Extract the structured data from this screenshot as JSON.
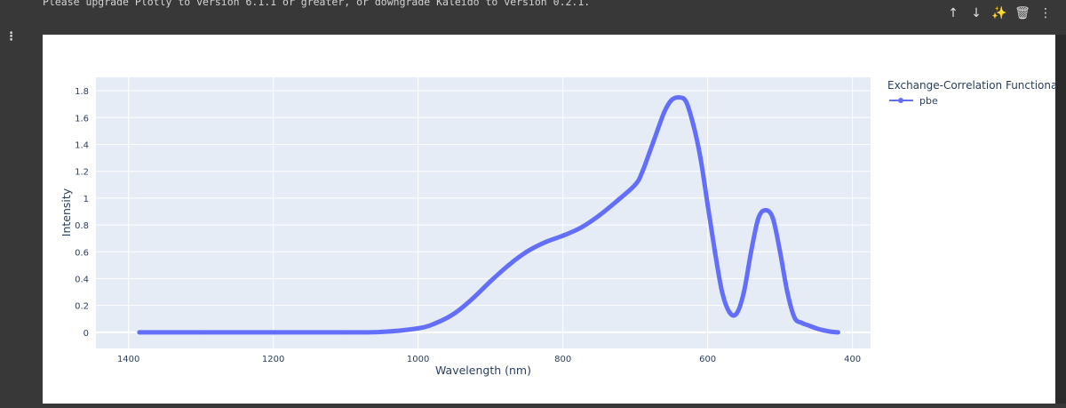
{
  "notebook": {
    "notice_text": "Please upgrade Plotly to version 6.1.1 or greater, or downgrade Kaleido to version 0.2.1.",
    "gutter_menu": "⋮",
    "toolbar": [
      {
        "name": "move-up-button",
        "glyph": "↑"
      },
      {
        "name": "move-down-button",
        "glyph": "↓"
      },
      {
        "name": "edit-magic-button",
        "glyph": "✨"
      },
      {
        "name": "delete-button",
        "glyph": "🗑"
      },
      {
        "name": "more-options-button",
        "glyph": "⋮"
      }
    ]
  },
  "chart_data": {
    "type": "line",
    "title": "",
    "xlabel": "Wavelength (nm)",
    "ylabel": "Intensity",
    "xlim": [
      1445,
      375
    ],
    "ylim": [
      -0.12,
      1.9
    ],
    "x_reversed": true,
    "xticks": [
      1400,
      1200,
      1000,
      800,
      600,
      400
    ],
    "yticks": [
      0,
      0.2,
      0.4,
      0.6,
      0.8,
      1,
      1.2,
      1.4,
      1.6,
      1.8
    ],
    "xtick_labels": [
      "1400",
      "1200",
      "1000",
      "800",
      "600",
      "400"
    ],
    "ytick_labels": [
      "0",
      "0.2",
      "0.4",
      "0.6",
      "0.8",
      "1",
      "1.2",
      "1.4",
      "1.6",
      "1.8"
    ],
    "grid": true,
    "plot_bg": "#e5ecf6",
    "legend": {
      "title": "Exchange-Correlation Functional",
      "placement": "top-right"
    },
    "series": [
      {
        "name": "pbe",
        "color": "#636efa",
        "x": [
          1385,
          1300,
          1200,
          1100,
          1050,
          1000,
          975,
          950,
          925,
          900,
          875,
          850,
          825,
          800,
          775,
          750,
          725,
          700,
          690,
          675,
          660,
          650,
          640,
          630,
          620,
          610,
          600,
          590,
          580,
          570,
          560,
          550,
          540,
          530,
          520,
          510,
          500,
          490,
          480,
          470,
          460,
          450,
          440,
          430,
          420
        ],
        "y": [
          0.0,
          0.0,
          0.0,
          0.0,
          0.003,
          0.03,
          0.07,
          0.14,
          0.25,
          0.38,
          0.5,
          0.6,
          0.67,
          0.72,
          0.78,
          0.87,
          0.98,
          1.1,
          1.2,
          1.42,
          1.64,
          1.73,
          1.75,
          1.72,
          1.55,
          1.3,
          0.95,
          0.6,
          0.3,
          0.15,
          0.14,
          0.3,
          0.6,
          0.85,
          0.91,
          0.85,
          0.6,
          0.3,
          0.11,
          0.07,
          0.05,
          0.03,
          0.015,
          0.005,
          0.0
        ]
      }
    ]
  }
}
